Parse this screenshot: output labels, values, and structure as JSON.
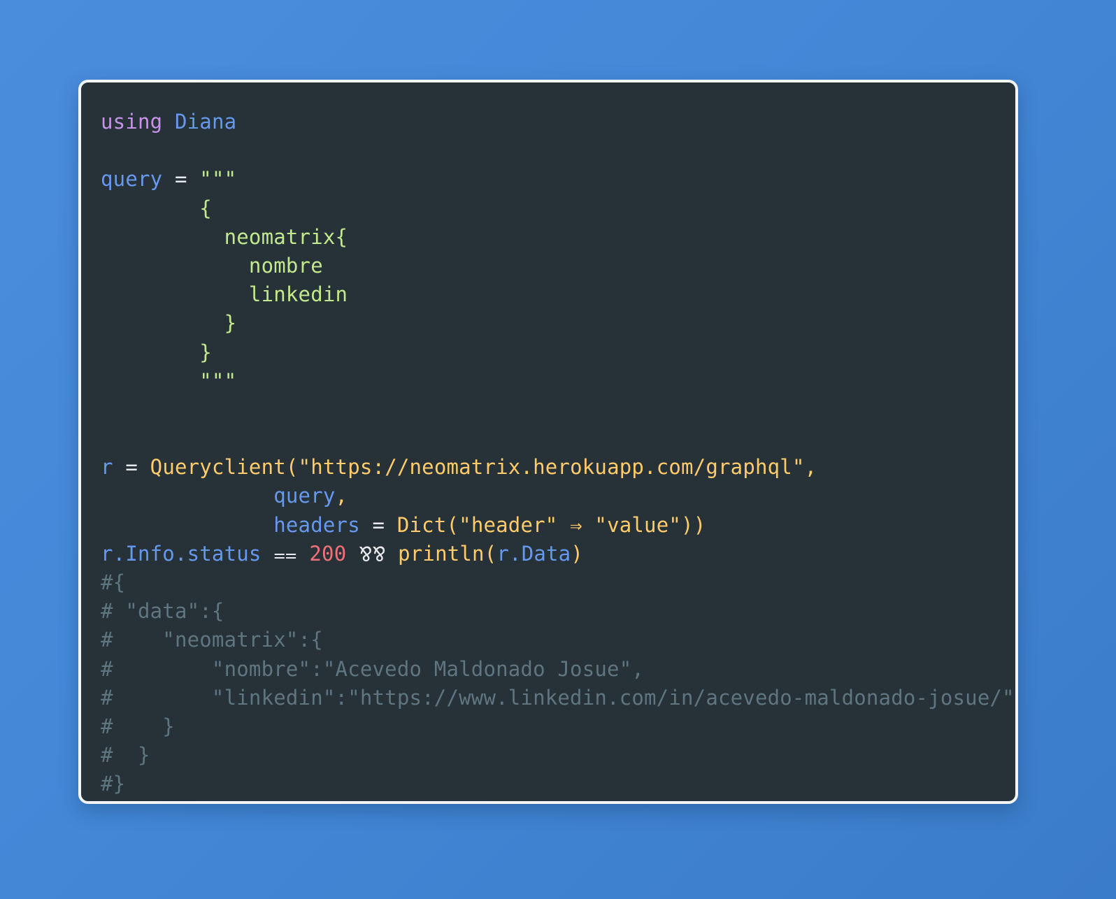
{
  "background": {
    "gradient_from": "#4a8ddd",
    "gradient_to": "#3b7cc9"
  },
  "window": {
    "background_color": "#263238",
    "border_color": "#f3f4f6",
    "language": "julia"
  },
  "palette": {
    "keyword": "#c792ea",
    "variable": "#6699ee",
    "string": "#ffcb6b",
    "function": "#ffcb6b",
    "graphql": "#c3e88d",
    "number": "#f07178",
    "operator": "#e8eaed",
    "comment": "#5f7580"
  },
  "code": {
    "lines": [
      {
        "n": 1,
        "tokens": [
          {
            "t": "using",
            "c": "tok-keyword"
          },
          {
            "t": " ",
            "c": "tok-op"
          },
          {
            "t": "Diana",
            "c": "tok-module"
          }
        ]
      },
      {
        "n": 2,
        "tokens": []
      },
      {
        "n": 3,
        "tokens": [
          {
            "t": "query",
            "c": "tok-var"
          },
          {
            "t": " = ",
            "c": "tok-op"
          },
          {
            "t": "\"\"\"",
            "c": "tok-gql"
          }
        ]
      },
      {
        "n": 4,
        "tokens": [
          {
            "t": "        {",
            "c": "tok-gql"
          }
        ]
      },
      {
        "n": 5,
        "tokens": [
          {
            "t": "          neomatrix{",
            "c": "tok-gql"
          }
        ]
      },
      {
        "n": 6,
        "tokens": [
          {
            "t": "            nombre",
            "c": "tok-gql"
          }
        ]
      },
      {
        "n": 7,
        "tokens": [
          {
            "t": "            linkedin",
            "c": "tok-gql"
          }
        ]
      },
      {
        "n": 8,
        "tokens": [
          {
            "t": "          }",
            "c": "tok-gql"
          }
        ]
      },
      {
        "n": 9,
        "tokens": [
          {
            "t": "        }",
            "c": "tok-gql"
          }
        ]
      },
      {
        "n": 10,
        "tokens": [
          {
            "t": "        \"\"\"",
            "c": "tok-gql"
          }
        ]
      },
      {
        "n": 11,
        "tokens": []
      },
      {
        "n": 12,
        "tokens": []
      },
      {
        "n": 13,
        "tokens": [
          {
            "t": "r",
            "c": "tok-var"
          },
          {
            "t": " = ",
            "c": "tok-op"
          },
          {
            "t": "Queryclient(",
            "c": "tok-func"
          },
          {
            "t": "\"https://neomatrix.herokuapp.com/graphql\",",
            "c": "tok-string"
          }
        ]
      },
      {
        "n": 14,
        "tokens": [
          {
            "t": "              ",
            "c": "tok-op"
          },
          {
            "t": "query",
            "c": "tok-var"
          },
          {
            "t": ",",
            "c": "tok-string"
          }
        ]
      },
      {
        "n": 15,
        "tokens": [
          {
            "t": "              ",
            "c": "tok-op"
          },
          {
            "t": "headers",
            "c": "tok-var"
          },
          {
            "t": " = ",
            "c": "tok-op"
          },
          {
            "t": "Dict(",
            "c": "tok-func"
          },
          {
            "t": "\"header\"",
            "c": "tok-string"
          },
          {
            "t": " ⇒ ",
            "c": "tok-string"
          },
          {
            "t": "\"value\"))",
            "c": "tok-string"
          }
        ]
      },
      {
        "n": 16,
        "tokens": [
          {
            "t": "r.Info.status",
            "c": "tok-var"
          },
          {
            "t": " ⩵ ",
            "c": "tok-op"
          },
          {
            "t": "200",
            "c": "tok-number"
          },
          {
            "t": " ⅋⅋ ",
            "c": "tok-op"
          },
          {
            "t": "println(",
            "c": "tok-func"
          },
          {
            "t": "r.Data",
            "c": "tok-var"
          },
          {
            "t": ")",
            "c": "tok-func"
          }
        ]
      },
      {
        "n": 17,
        "tokens": [
          {
            "t": "#{",
            "c": "tok-comment"
          }
        ]
      },
      {
        "n": 18,
        "tokens": [
          {
            "t": "# \"data\":{",
            "c": "tok-comment"
          }
        ]
      },
      {
        "n": 19,
        "tokens": [
          {
            "t": "#    \"neomatrix\":{",
            "c": "tok-comment"
          }
        ]
      },
      {
        "n": 20,
        "tokens": [
          {
            "t": "#        \"nombre\":\"Acevedo Maldonado Josue\",",
            "c": "tok-comment"
          }
        ]
      },
      {
        "n": 21,
        "tokens": [
          {
            "t": "#        \"linkedin\":\"https://www.linkedin.com/in/acevedo-maldonado-josue/\"",
            "c": "tok-comment"
          }
        ]
      },
      {
        "n": 22,
        "tokens": [
          {
            "t": "#    }",
            "c": "tok-comment"
          }
        ]
      },
      {
        "n": 23,
        "tokens": [
          {
            "t": "#  }",
            "c": "tok-comment"
          }
        ]
      },
      {
        "n": 24,
        "tokens": [
          {
            "t": "#}",
            "c": "tok-comment"
          }
        ]
      }
    ],
    "plain_text": "using Diana\n\nquery = \"\"\"\n        {\n          neomatrix{\n            nombre\n            linkedin\n          }\n        }\n        \"\"\"\n\n\nr = Queryclient(\"https://neomatrix.herokuapp.com/graphql\",\n              query,\n              headers = Dict(\"header\" => \"value\"))\nr.Info.status == 200 && println(r.Data)\n#{\n# \"data\":{\n#    \"neomatrix\":{\n#        \"nombre\":\"Acevedo Maldonado Josue\",\n#        \"linkedin\":\"https://www.linkedin.com/in/acevedo-maldonado-josue/\"\n#    }\n#  }\n#}"
  }
}
